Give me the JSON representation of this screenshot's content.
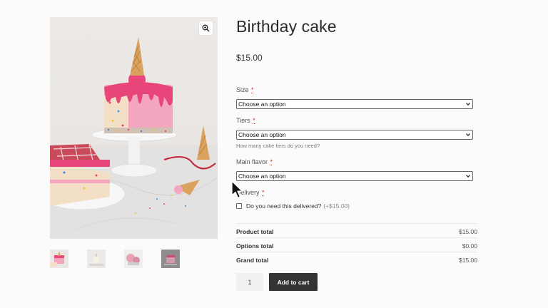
{
  "product": {
    "title": "Birthday cake",
    "price": "$15.00",
    "image_alt": "Pink drip birthday cake with ice cream cones"
  },
  "gallery": {
    "zoom_icon": "magnify-icon",
    "thumbnails": [
      "thumb-1",
      "thumb-2",
      "thumb-3",
      "thumb-4"
    ]
  },
  "fields": {
    "size": {
      "label": "Size",
      "required_mark": "*",
      "value": "Choose an option"
    },
    "tiers": {
      "label": "Tiers",
      "required_mark": "*",
      "value": "Choose an option",
      "hint": "How many cake tiers do you need?"
    },
    "flavor": {
      "label": "Main flavor",
      "required_mark": "*",
      "value": "Choose an option"
    },
    "delivery": {
      "label": "Delivery",
      "required_mark": "*",
      "checkbox_label": "Do you need this delivered?",
      "extra": "(+$15.00)"
    }
  },
  "totals": {
    "product_total_label": "Product total",
    "product_total_value": "$15.00",
    "options_total_label": "Options total",
    "options_total_value": "$0.00",
    "grand_total_label": "Grand total",
    "grand_total_value": "$15.00"
  },
  "cart": {
    "quantity": "1",
    "add_label": "Add to cart"
  },
  "colors": {
    "button_bg": "#333333",
    "cake_pink": "#e8457a",
    "required": "#c0392b"
  }
}
